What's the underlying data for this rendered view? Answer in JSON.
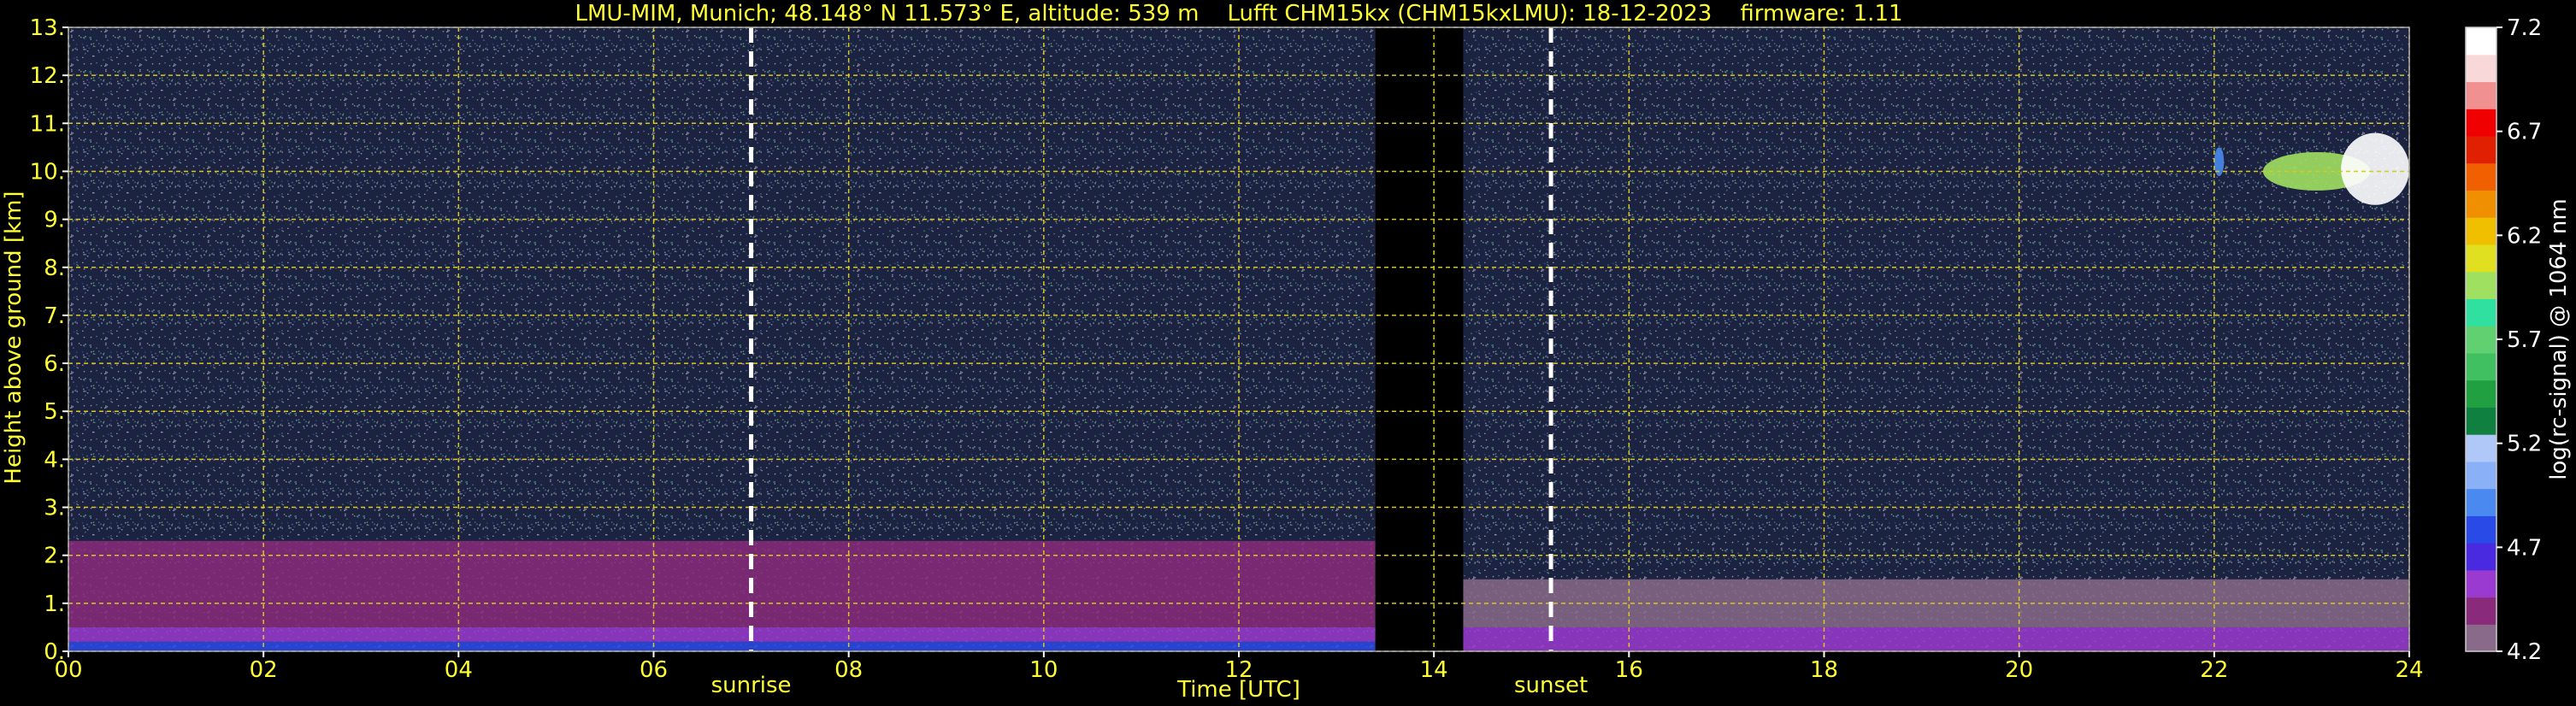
{
  "chart_data": {
    "type": "heatmap",
    "title": "LMU-MIM, Munich; 48.148° N 11.573° E, altitude: 539 m    Lufft CHM15kx (CHM15kxLMU): 18-12-2023    firmware: 1.11",
    "xlabel": "Time [UTC]",
    "ylabel": "Height above ground [km]",
    "xlim": [
      0,
      24
    ],
    "ylim": [
      0,
      13
    ],
    "x_ticks": [
      "00",
      "02",
      "04",
      "06",
      "08",
      "10",
      "12",
      "14",
      "16",
      "18",
      "20",
      "22",
      "24"
    ],
    "y_ticks": [
      "0.",
      "1.",
      "2.",
      "3.",
      "4.",
      "5.",
      "6.",
      "7.",
      "8.",
      "9.",
      "10.",
      "11.",
      "12.",
      "13."
    ],
    "grid": true,
    "annotations": [
      {
        "label": "sunrise",
        "x": 7.0
      },
      {
        "label": "sunset",
        "x": 15.2
      }
    ],
    "data_gap": [
      13.4,
      14.3
    ],
    "layers": [
      {
        "name": "surface",
        "x_range": [
          0,
          13.4
        ],
        "height_range": [
          0,
          0.2
        ],
        "level": 4.75
      },
      {
        "name": "boundary layer",
        "x_range": [
          0,
          13.4
        ],
        "height_range": [
          0.2,
          0.5
        ],
        "level": 4.5
      },
      {
        "name": "residual layer",
        "x_range": [
          0,
          13.4
        ],
        "height_range": [
          0.5,
          2.3
        ],
        "level": 4.35
      },
      {
        "name": "evening boundary layer",
        "x_range": [
          14.3,
          24
        ],
        "height_range": [
          0,
          0.5
        ],
        "level": 4.5
      },
      {
        "name": "evening residual layer",
        "x_range": [
          14.3,
          24
        ],
        "height_range": [
          0.5,
          1.5
        ],
        "level": 4.3
      }
    ],
    "clouds": [
      {
        "x_range": [
          22.0,
          22.1
        ],
        "height_range": [
          9.9,
          10.5
        ],
        "level": 4.9
      },
      {
        "x_range": [
          22.5,
          23.6
        ],
        "height_range": [
          9.6,
          10.4
        ],
        "level": 6.0
      },
      {
        "x_range": [
          23.3,
          24.0
        ],
        "height_range": [
          9.3,
          10.8
        ],
        "level": 7.2
      }
    ],
    "colorbar": {
      "label": "log(rc-signal) @ 1064 nm",
      "ticks": [
        "7.2",
        "6.7",
        "6.2",
        "5.7",
        "5.2",
        "4.7",
        "4.2"
      ],
      "min": 4.2,
      "max": 7.2,
      "colors": [
        "#8a6a8a",
        "#8a2a7a",
        "#9a3ad0",
        "#4a2ae0",
        "#2a4ae8",
        "#4a8af0",
        "#8ab0f8",
        "#b0c8f8",
        "#108040",
        "#20a040",
        "#40c060",
        "#60d070",
        "#30e0a0",
        "#a0e060",
        "#e0e020",
        "#f0c000",
        "#f09000",
        "#f06000",
        "#e02000",
        "#f00000",
        "#f09090",
        "#f8d8d8",
        "#ffffff"
      ]
    }
  }
}
